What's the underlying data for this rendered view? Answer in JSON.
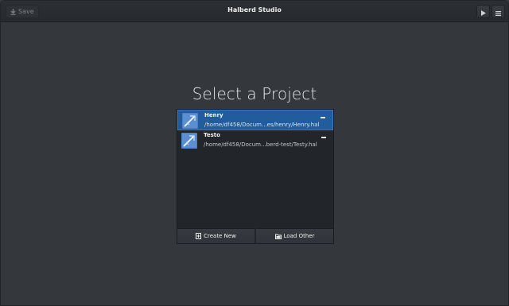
{
  "header": {
    "title": "Halberd Studio",
    "save_label": "Save",
    "icons": {
      "save": "download-arrow-icon",
      "play": "play-icon",
      "menu": "hamburger-menu-icon"
    }
  },
  "main": {
    "heading": "Select a Project",
    "projects": [
      {
        "name": "Henry",
        "path": "/home/df458/Docum...es/henry/Henry.hal",
        "selected": true
      },
      {
        "name": "Testo",
        "path": "/home/df458/Docum...berd-test/Testy.hal",
        "selected": false
      }
    ],
    "create_label": "Create New",
    "load_label": "Load Other"
  },
  "colors": {
    "selection": "#215d9c",
    "background": "#34383d",
    "panel": "#22262a"
  }
}
